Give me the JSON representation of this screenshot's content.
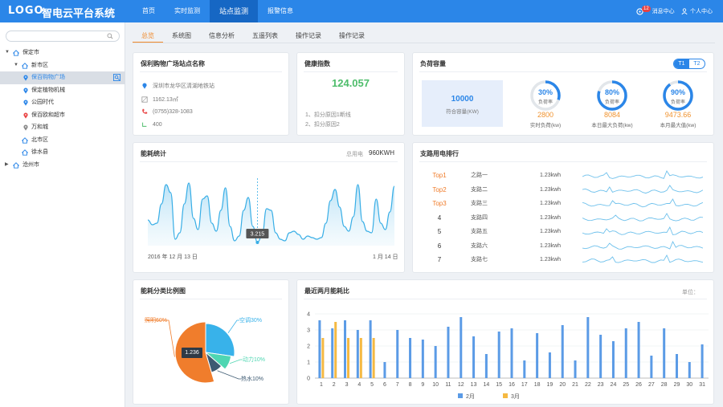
{
  "header": {
    "logo": "LOGO",
    "app_title": "智电云平台系统",
    "nav": [
      {
        "label": "首页",
        "active": false
      },
      {
        "label": "实时监测",
        "active": false
      },
      {
        "label": "站点监测",
        "active": true
      },
      {
        "label": "报警信息",
        "active": false
      }
    ],
    "message_count": "12",
    "message_label": "消息中心",
    "user_label": "个人中心"
  },
  "sidebar": {
    "search_placeholder": "",
    "tree": [
      {
        "label": "保定市",
        "level": 0,
        "expanded": true
      },
      {
        "label": "新市区",
        "level": 1,
        "expanded": true
      },
      {
        "label": "保百购物广场",
        "level": 2,
        "selected": true
      },
      {
        "label": "保定植物机械",
        "level": 2
      },
      {
        "label": "公园时代",
        "level": 2
      },
      {
        "label": "保百欧和超市",
        "level": 2
      },
      {
        "label": "万和城",
        "level": 2
      },
      {
        "label": "北市区",
        "level": 1
      },
      {
        "label": "徐水县",
        "level": 1
      },
      {
        "label": "沧州市",
        "level": 0,
        "expanded": false
      }
    ]
  },
  "tabs": [
    {
      "label": "总览",
      "active": true
    },
    {
      "label": "系统图",
      "active": false
    },
    {
      "label": "信息分析",
      "active": false
    },
    {
      "label": "五遥列表",
      "active": false
    },
    {
      "label": "操作记录",
      "active": false
    },
    {
      "label": "操作记录",
      "active": false
    }
  ],
  "site_card": {
    "title": "保利购物广场站点名称",
    "address": "深圳市龙华区清湖地铁站",
    "area": "1162.13㎡",
    "phone": "(0755)328-1083",
    "capacity": "400"
  },
  "health_card": {
    "title": "健康指数",
    "value": "124.057",
    "reasons": [
      "1、扣分原因1断线",
      "2、扣分原因2"
    ]
  },
  "load_card": {
    "title": "负荷容量",
    "toggle": [
      "T1",
      "T2"
    ],
    "capacity_value": "10000",
    "capacity_label": "符合容量(KW)",
    "gauges": [
      {
        "pct": "30%",
        "pct_num": 30,
        "sub": "负荷率",
        "value": "2800",
        "label": "实时负荷(kw)"
      },
      {
        "pct": "80%",
        "pct_num": 80,
        "sub": "负荷率",
        "value": "8084",
        "label": "本日最大负荷(kw)"
      },
      {
        "pct": "90%",
        "pct_num": 90,
        "sub": "负荷率",
        "value": "9473.66",
        "label": "本月最大值(kw)"
      }
    ]
  },
  "energy_card": {
    "title": "能耗统计",
    "total_label": "总用电",
    "total_value": "960KWH",
    "tooltip": "3.215",
    "start_date": "2016 年 12 月 13 日",
    "end_date": "1 月 14 日"
  },
  "branch_card": {
    "title": "支路用电排行",
    "rows": [
      {
        "rank": "Top1",
        "name": "之路一",
        "value": "1.23kwh",
        "top": true
      },
      {
        "rank": "Top2",
        "name": "支路二",
        "value": "1.23kwh",
        "top": true
      },
      {
        "rank": "Top3",
        "name": "支路三",
        "value": "1.23kwh",
        "top": true
      },
      {
        "rank": "4",
        "name": "支路四",
        "value": "1.23kwh",
        "top": false
      },
      {
        "rank": "5",
        "name": "支路五",
        "value": "1.23kwh",
        "top": false
      },
      {
        "rank": "6",
        "name": "支路六",
        "value": "1.23kwh",
        "top": false
      },
      {
        "rank": "7",
        "name": "支路七",
        "value": "1.23kwh",
        "top": false
      }
    ]
  },
  "pie_card": {
    "title": "能耗分类比例图",
    "center_value": "1.236"
  },
  "bar_card": {
    "title": "最近两月能耗比",
    "unit_label": "单位："
  },
  "chart_data": [
    {
      "type": "pie",
      "title": "能耗分类比例图",
      "labels": [
        "空调30%",
        "动力10%",
        "热水10%",
        "照明60%"
      ],
      "values": [
        30,
        10,
        10,
        60
      ],
      "colors": [
        "#38b2ea",
        "#4fd6b2",
        "#3d5a72",
        "#f07d2c"
      ]
    },
    {
      "type": "bar",
      "title": "最近两月能耗比",
      "categories": [
        "1",
        "2",
        "3",
        "4",
        "5",
        "6",
        "7",
        "8",
        "9",
        "10",
        "11",
        "12",
        "13",
        "14",
        "15",
        "16",
        "17",
        "18",
        "19",
        "20",
        "21",
        "22",
        "23",
        "24",
        "25",
        "26",
        "27",
        "28",
        "29",
        "30",
        "31"
      ],
      "ylim": [
        0,
        4
      ],
      "yticks": [
        0,
        1,
        2,
        3,
        4
      ],
      "series": [
        {
          "name": "2月",
          "color": "#5b9be6",
          "values": [
            3.6,
            3.1,
            3.6,
            3.0,
            3.6,
            1.0,
            3.0,
            2.5,
            2.4,
            2.0,
            3.2,
            3.8,
            2.6,
            1.5,
            2.9,
            3.1,
            1.1,
            2.8,
            1.6,
            3.3,
            1.1,
            3.8,
            2.7,
            2.3,
            3.1,
            3.5,
            1.4,
            3.1,
            1.5,
            1.0,
            2.1
          ]
        },
        {
          "name": "3月",
          "color": "#f5b942",
          "values": [
            2.5,
            3.5,
            2.5,
            2.5,
            2.5,
            null,
            null,
            null,
            null,
            null,
            null,
            null,
            null,
            null,
            null,
            null,
            null,
            null,
            null,
            null,
            null,
            null,
            null,
            null,
            null,
            null,
            null,
            null,
            null,
            null,
            null
          ]
        }
      ]
    },
    {
      "type": "area",
      "title": "能耗统计",
      "x": [
        "2016 年 12 月 13 日",
        "1 月 14 日"
      ],
      "values": [
        1.6,
        1.3,
        1.4,
        2.6,
        3.8,
        3.3,
        0.4,
        0.8,
        2.6,
        3.9,
        1.7,
        1.0,
        2.9,
        3.1,
        1.4,
        0.9,
        2.2,
        3.6,
        1.2,
        0.3,
        0.6,
        2.2,
        3.0,
        1.2,
        0.2,
        0.6,
        2.3,
        2.2,
        0.8,
        0.4,
        0.3,
        0.8,
        0.9,
        0.7,
        0.4,
        0.6,
        0.5,
        0.4,
        0.5,
        1.4,
        2.8,
        3.5,
        2.4,
        1.2,
        0.9,
        1.8,
        3.8,
        1.5,
        0.9,
        0.8,
        2.9,
        1.4,
        1.0,
        2.1,
        3.7
      ],
      "highlight_index": 24,
      "highlight_value": "3.215"
    }
  ]
}
